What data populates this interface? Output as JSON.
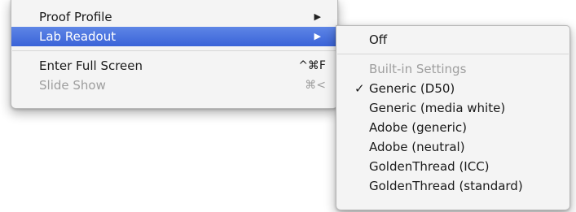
{
  "main_menu": {
    "items": [
      {
        "label": "Proof Profile",
        "arrow": "▶"
      },
      {
        "label": "Lab Readout",
        "arrow": "▶"
      },
      {
        "label": "Enter Full Screen",
        "shortcut": "^⌘F"
      },
      {
        "label": "Slide Show",
        "shortcut": "⌘<"
      }
    ]
  },
  "submenu": {
    "off_label": "Off",
    "section_header": "Built-in Settings",
    "checkmark": "✓",
    "items": [
      {
        "label": "Generic (D50)",
        "checked": true
      },
      {
        "label": "Generic (media white)"
      },
      {
        "label": "Adobe (generic)"
      },
      {
        "label": "Adobe (neutral)"
      },
      {
        "label": "GoldenThread (ICC)"
      },
      {
        "label": "GoldenThread (standard)"
      }
    ]
  },
  "colors": {
    "highlight": "#3a63d8",
    "menu_background": "#f4f4f4",
    "disabled_text": "#9e9e9e"
  }
}
